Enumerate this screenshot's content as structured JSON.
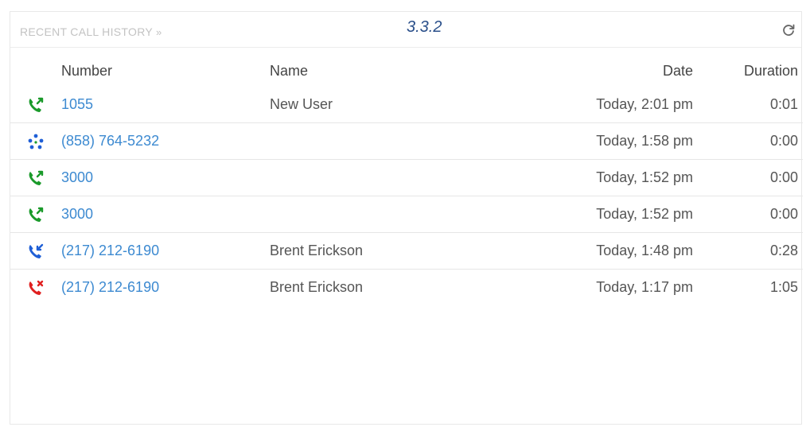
{
  "panel": {
    "title": "RECENT CALL HISTORY",
    "title_chevron": "»",
    "version": "3.3.2",
    "refresh_icon": "refresh-icon"
  },
  "columns": {
    "number": "Number",
    "name": "Name",
    "date": "Date",
    "duration": "Duration"
  },
  "calls": [
    {
      "type": "outgoing",
      "icon": "outgoing-call-icon",
      "color": "#1a9a2a",
      "number": "1055",
      "name": "New User",
      "date": "Today, 2:01 pm",
      "duration": "0:01"
    },
    {
      "type": "conference",
      "icon": "conference-call-icon",
      "color": "#1f5fd6",
      "number": "(858) 764-5232",
      "name": "",
      "date": "Today, 1:58 pm",
      "duration": "0:00"
    },
    {
      "type": "outgoing",
      "icon": "outgoing-call-icon",
      "color": "#1a9a2a",
      "number": "3000",
      "name": "",
      "date": "Today, 1:52 pm",
      "duration": "0:00"
    },
    {
      "type": "outgoing",
      "icon": "outgoing-call-icon",
      "color": "#1a9a2a",
      "number": "3000",
      "name": "",
      "date": "Today, 1:52 pm",
      "duration": "0:00"
    },
    {
      "type": "incoming",
      "icon": "incoming-call-icon",
      "color": "#1f5fd6",
      "number": "(217) 212-6190",
      "name": "Brent Erickson",
      "date": "Today, 1:48 pm",
      "duration": "0:28"
    },
    {
      "type": "missed",
      "icon": "missed-call-icon",
      "color": "#e02020",
      "number": "(217) 212-6190",
      "name": "Brent Erickson",
      "date": "Today, 1:17 pm",
      "duration": "1:05"
    }
  ]
}
